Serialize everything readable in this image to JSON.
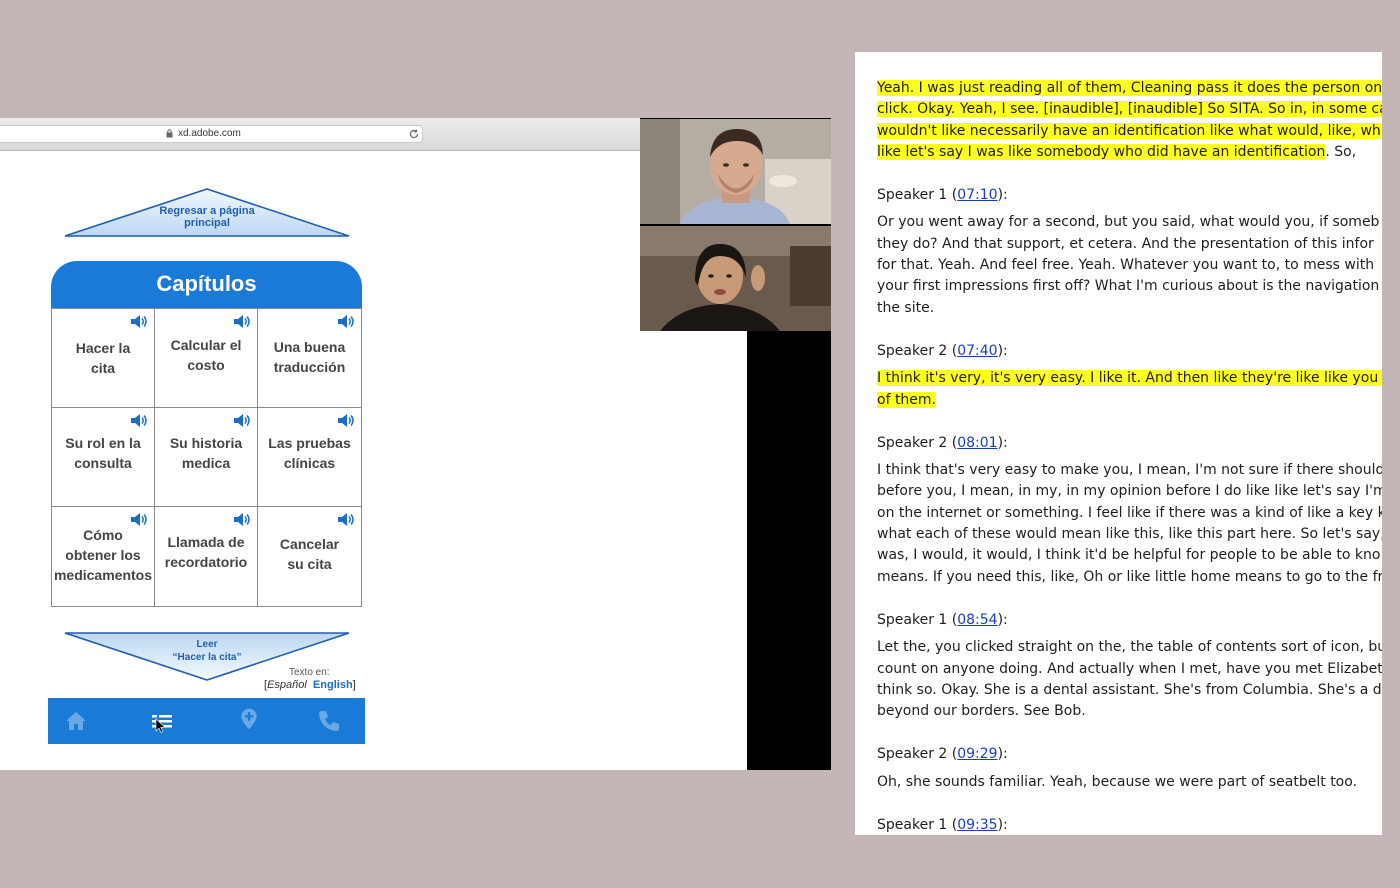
{
  "browser": {
    "url": "xd.adobe.com"
  },
  "prototype": {
    "back_button": [
      "Regresar a página",
      "principal"
    ],
    "chapters_title": "Capítulos",
    "chapters": [
      [
        "Hacer la",
        "cita"
      ],
      [
        "Calcular el",
        "costo"
      ],
      [
        "Una buena",
        "traducción"
      ],
      [
        "Su rol en la",
        "consulta"
      ],
      [
        "Su historia",
        "medica"
      ],
      [
        "Las pruebas",
        "clínicas"
      ],
      [
        "Cómo",
        "obtener los",
        "medicamentos"
      ],
      [
        "Llamada de",
        "recordatorio"
      ],
      [
        "Cancelar",
        "su cita"
      ]
    ],
    "read_button": [
      "Leer",
      "“Hacer la cita”"
    ],
    "language": {
      "caption": "Texto en:",
      "open_bracket": "[",
      "spanish": "Español",
      "english": "English",
      "close_bracket": "]"
    },
    "nav_icons": [
      "home-icon",
      "table-of-contents-icon",
      "location-pin-icon",
      "phone-icon"
    ],
    "colors": {
      "accent": "#1a7ad8",
      "triangle_light": "#cfe3f6",
      "triangle_border": "#1f5fb0"
    }
  },
  "video_call": {
    "participants": [
      "participant-1",
      "participant-2"
    ]
  },
  "transcript": {
    "opening": [
      "Yeah. I was just reading all of them, Cleaning pass it does the person on",
      "click. Okay. Yeah, I see. [inaudible], [inaudible] So SITA. So in, in some ca",
      "wouldn't like necessarily have an identification like what would, like, wh",
      "like let's say I was like somebody who did have an identification",
      ". So,"
    ],
    "entries": [
      {
        "speaker": "Speaker 1 (",
        "time": "07:10",
        "close": "):",
        "highlight": false,
        "lines": [
          "Or you went away for a second, but you said, what would you, if someb",
          "they do? And that support, et cetera. And the presentation of this infor",
          "for that. Yeah. And feel free. Yeah. Whatever you want to, to mess with",
          "your first impressions first off? What I'm curious about is the navigation",
          "the site."
        ]
      },
      {
        "speaker": "Speaker 2 (",
        "time": "07:40",
        "close": "):",
        "highlight": true,
        "lines": [
          "I think it's very, it's very easy. I like it. And then like they're like like you c",
          "of them."
        ]
      },
      {
        "speaker": "Speaker 2 (",
        "time": "08:01",
        "close": "):",
        "highlight": false,
        "lines": [
          "I think that's very easy to make you, I mean, I'm not sure if there should",
          "before you, I mean, in my, in my opinion before I do like like let's say I'm",
          "on the internet or something. I feel like if there was a kind of like a key k",
          "what each of these would mean like this, like this part here. So let's say,",
          "was, I would, it would, I think it'd be helpful for people to be able to kno",
          "means. If you need this, like, Oh or like little home means to go to the fr"
        ]
      },
      {
        "speaker": "Speaker 1 (",
        "time": "08:54",
        "close": "):",
        "highlight": false,
        "lines": [
          "Let the, you clicked straight on the, the table of contents sort of icon, bu",
          "count on anyone doing. And actually when I met, have you met Elizabet",
          "think so. Okay. She is a dental assistant. She's from Columbia. She's a de",
          "beyond our borders. See Bob."
        ]
      },
      {
        "speaker": "Speaker 2 (",
        "time": "09:29",
        "close": "):",
        "highlight": false,
        "lines": [
          "Oh, she sounds familiar. Yeah, because we were part of seatbelt too."
        ]
      },
      {
        "speaker": "Speaker 1 (",
        "time": "09:35",
        "close": "):",
        "highlight": false,
        "lines": []
      }
    ]
  }
}
